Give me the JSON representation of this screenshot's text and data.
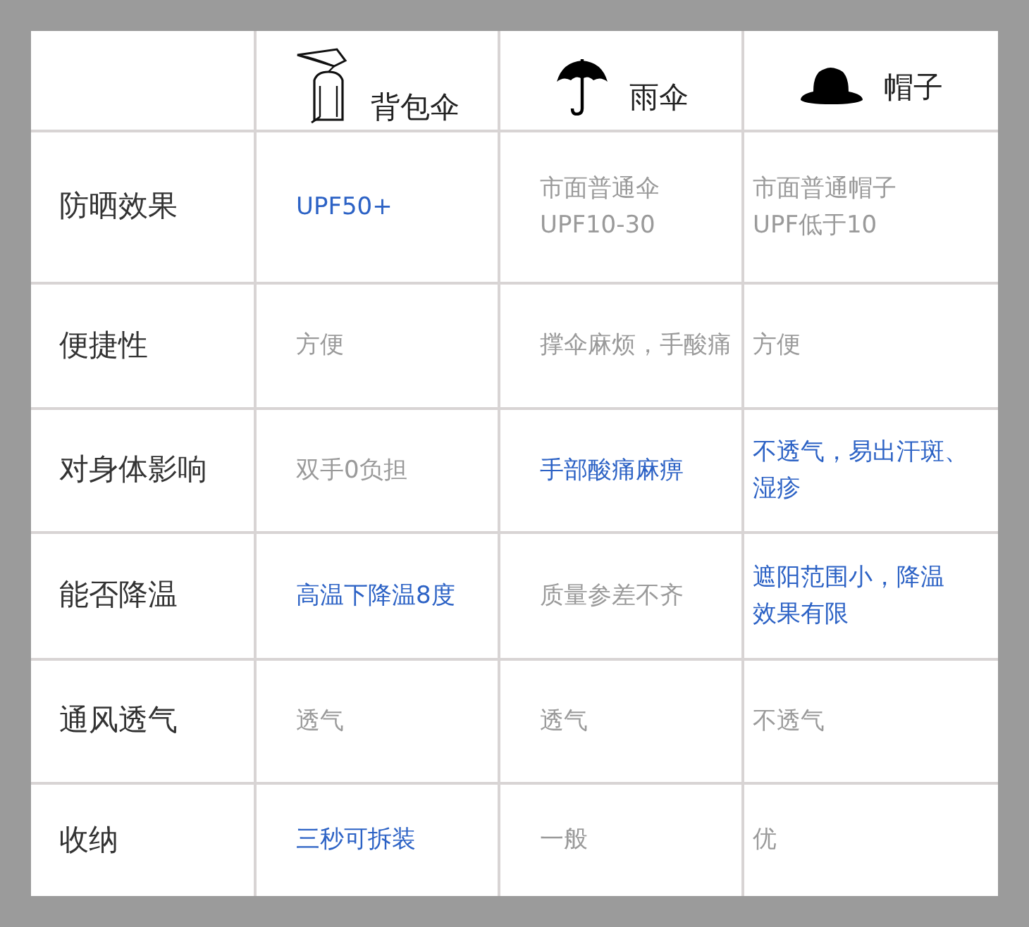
{
  "columns": [
    "背包伞",
    "雨伞",
    "帽子"
  ],
  "rows": [
    {
      "label": "防晒效果",
      "cells": [
        {
          "lines": [
            "UPF50+"
          ],
          "highlight": true
        },
        {
          "lines": [
            "市面普通伞",
            "UPF10-30"
          ],
          "highlight": false
        },
        {
          "lines": [
            "市面普通帽子",
            "UPF低于10"
          ],
          "highlight": false
        }
      ]
    },
    {
      "label": "便捷性",
      "cells": [
        {
          "lines": [
            "方便"
          ],
          "highlight": false
        },
        {
          "lines": [
            "撑伞麻烦，手酸痛"
          ],
          "highlight": false
        },
        {
          "lines": [
            "方便"
          ],
          "highlight": false
        }
      ]
    },
    {
      "label": "对身体影响",
      "cells": [
        {
          "lines": [
            "双手0负担"
          ],
          "highlight": false
        },
        {
          "lines": [
            "手部酸痛麻痹"
          ],
          "highlight": true
        },
        {
          "lines": [
            "不透气，易出汗斑、",
            "湿疹"
          ],
          "highlight": true
        }
      ]
    },
    {
      "label": "能否降温",
      "cells": [
        {
          "lines": [
            "高温下降温8度"
          ],
          "highlight": true
        },
        {
          "lines": [
            "质量参差不齐"
          ],
          "highlight": false
        },
        {
          "lines": [
            "遮阳范围小，降温",
            "效果有限"
          ],
          "highlight": true
        }
      ]
    },
    {
      "label": "通风透气",
      "cells": [
        {
          "lines": [
            "透气"
          ],
          "highlight": false
        },
        {
          "lines": [
            "透气"
          ],
          "highlight": false
        },
        {
          "lines": [
            "不透气"
          ],
          "highlight": false
        }
      ]
    },
    {
      "label": "收纳",
      "cells": [
        {
          "lines": [
            "三秒可拆装"
          ],
          "highlight": true
        },
        {
          "lines": [
            "一般"
          ],
          "highlight": false
        },
        {
          "lines": [
            "优"
          ],
          "highlight": false
        }
      ]
    }
  ]
}
